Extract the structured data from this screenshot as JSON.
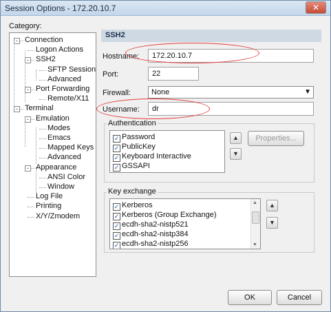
{
  "window": {
    "title": "Session Options - 172.20.10.7",
    "close_glyph": "✕"
  },
  "category_label": "Category:",
  "tree": [
    {
      "label": "Connection",
      "level": 0,
      "exp": "-"
    },
    {
      "label": "Logon Actions",
      "level": 1
    },
    {
      "label": "SSH2",
      "level": 1,
      "exp": "-"
    },
    {
      "label": "SFTP Session",
      "level": 2
    },
    {
      "label": "Advanced",
      "level": 2
    },
    {
      "label": "Port Forwarding",
      "level": 1,
      "exp": "-"
    },
    {
      "label": "Remote/X11",
      "level": 2
    },
    {
      "label": "Terminal",
      "level": 0,
      "exp": "-"
    },
    {
      "label": "Emulation",
      "level": 1,
      "exp": "-"
    },
    {
      "label": "Modes",
      "level": 2
    },
    {
      "label": "Emacs",
      "level": 2
    },
    {
      "label": "Mapped Keys",
      "level": 2
    },
    {
      "label": "Advanced",
      "level": 2
    },
    {
      "label": "Appearance",
      "level": 1,
      "exp": "-"
    },
    {
      "label": "ANSI Color",
      "level": 2
    },
    {
      "label": "Window",
      "level": 2
    },
    {
      "label": "Log File",
      "level": 1
    },
    {
      "label": "Printing",
      "level": 1
    },
    {
      "label": "X/Y/Zmodem",
      "level": 1
    }
  ],
  "ssh2": {
    "header": "SSH2",
    "hostname_label": "Hostname:",
    "hostname_value": "172.20.10.7",
    "port_label": "Port:",
    "port_value": "22",
    "firewall_label": "Firewall:",
    "firewall_value": "None",
    "username_label": "Username:",
    "username_value": "dr"
  },
  "authentication": {
    "label": "Authentication",
    "items": [
      {
        "label": "Password",
        "checked": true
      },
      {
        "label": "PublicKey",
        "checked": true
      },
      {
        "label": "Keyboard Interactive",
        "checked": true
      },
      {
        "label": "GSSAPI",
        "checked": true
      }
    ],
    "properties_label": "Properties..."
  },
  "key_exchange": {
    "label": "Key exchange",
    "items": [
      {
        "label": "Kerberos",
        "checked": true
      },
      {
        "label": "Kerberos (Group Exchange)",
        "checked": true
      },
      {
        "label": "ecdh-sha2-nistp521",
        "checked": true
      },
      {
        "label": "ecdh-sha2-nistp384",
        "checked": true
      },
      {
        "label": "ecdh-sha2-nistp256",
        "checked": true
      }
    ]
  },
  "buttons": {
    "ok": "OK",
    "cancel": "Cancel"
  },
  "glyphs": {
    "up": "▲",
    "down": "▼",
    "check": "✓",
    "dropdown": "▼"
  },
  "accent_colors": {
    "annotation_ellipse": "#e53d3d"
  }
}
